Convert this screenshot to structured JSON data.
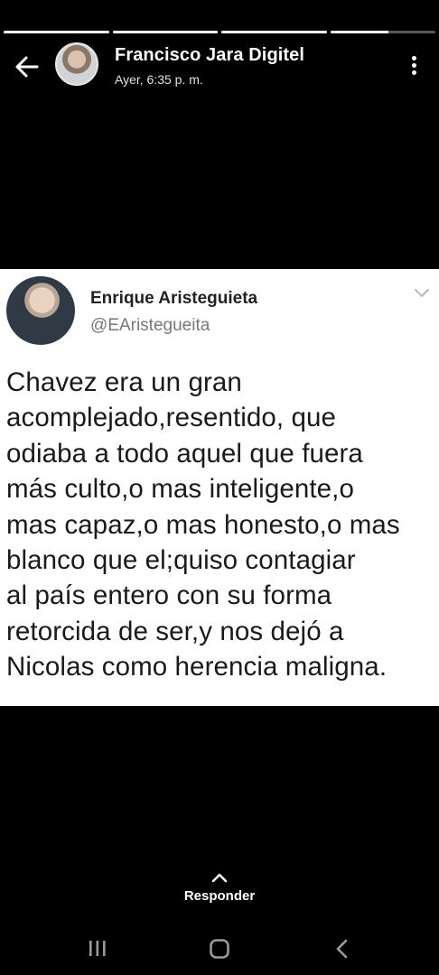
{
  "story": {
    "progress": [
      1,
      1,
      1,
      0.55
    ],
    "author": "Francisco Jara Digitel",
    "timestamp": "Ayer, 6:35 p. m."
  },
  "tweet": {
    "name": "Enrique Aristeguieta",
    "handle": "@EAristegueita",
    "lines": [
      "Chavez era un gran",
      "acomplejado,resentido, que",
      "odiaba a todo aquel que fuera",
      "más culto,o mas inteligente,o",
      "mas capaz,o mas honesto,o mas",
      "blanco que el;quiso contagiar",
      "al país entero con su forma",
      "retorcida de ser,y nos dejó a",
      "Nicolas como herencia maligna."
    ]
  },
  "reply": {
    "label": "Responder"
  },
  "icons": {
    "back": "arrow-left-icon",
    "menu": "more-vertical-icon",
    "reply": "chevron-up-icon",
    "recents": "recents-icon",
    "home": "home-icon",
    "nav_back": "chevron-left-icon"
  }
}
